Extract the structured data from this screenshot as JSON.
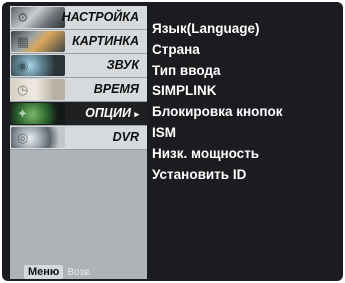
{
  "sidebar": {
    "items": [
      {
        "label": "НАСТРОЙКА",
        "icon": "setup-icon"
      },
      {
        "label": "КАРТИНКА",
        "icon": "picture-icon"
      },
      {
        "label": "ЗВУК",
        "icon": "audio-icon"
      },
      {
        "label": "ВРЕМЯ",
        "icon": "time-icon"
      },
      {
        "label": "ОПЦИИ",
        "icon": "option-icon",
        "active": true
      },
      {
        "label": "DVR",
        "icon": "dvr-icon"
      }
    ],
    "active_arrow": "▸"
  },
  "options": [
    "Язык(Language)",
    "Страна",
    "Тип ввода",
    "SIMPLINK",
    "Блокировка кнопок",
    "ISM",
    "Низк. мощность",
    "Установить ID"
  ],
  "footer": {
    "menu_label": "Меню",
    "back_label": "Возв."
  },
  "colors": {
    "background": "#1b1c1f",
    "sidebar": "#aeb3b7",
    "item": "#d7dadc",
    "active_item": "#1f2022",
    "text_on_dark": "#ffffff"
  }
}
